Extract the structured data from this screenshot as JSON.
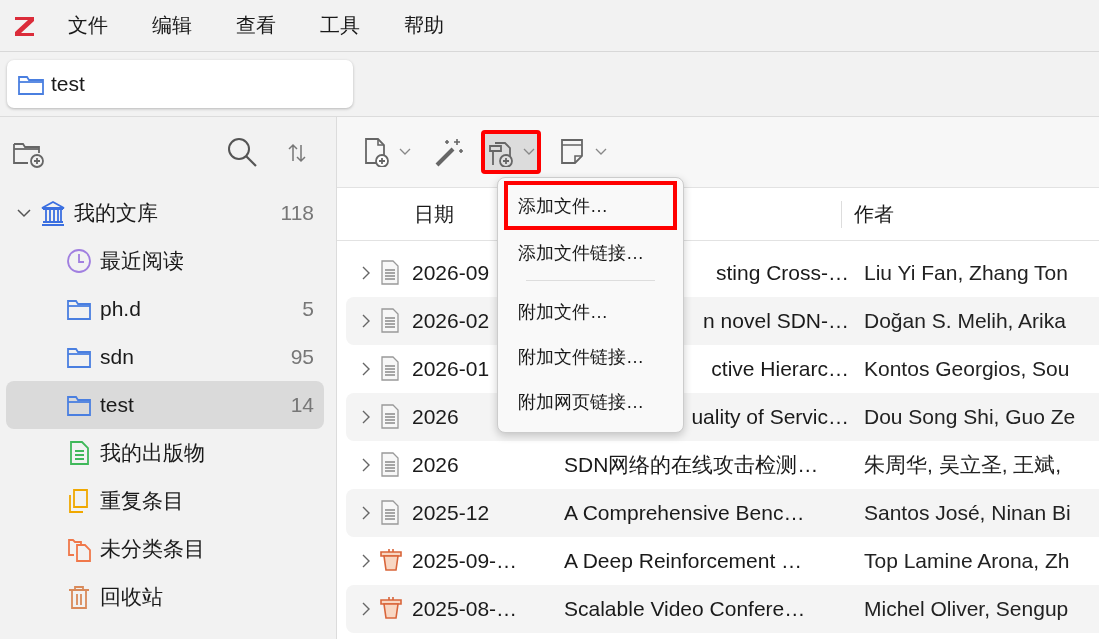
{
  "menu_bar": {
    "items": [
      "文件",
      "编辑",
      "查看",
      "工具",
      "帮助"
    ]
  },
  "tabs": [
    {
      "label": "test",
      "selected": true
    }
  ],
  "sidebar": {
    "items": [
      {
        "kind": "library",
        "label": "我的文库",
        "count": "118",
        "expanded": true,
        "selected": false,
        "children": [
          {
            "kind": "recent",
            "label": "最近阅读",
            "selected": false
          },
          {
            "kind": "folder",
            "label": "ph.d",
            "count": "5",
            "selected": false
          },
          {
            "kind": "folder",
            "label": "sdn",
            "count": "95",
            "selected": false
          },
          {
            "kind": "folder",
            "label": "test",
            "count": "14",
            "selected": true
          },
          {
            "kind": "publications",
            "label": "我的出版物",
            "selected": false
          },
          {
            "kind": "duplicates",
            "label": "重复条目",
            "selected": false
          },
          {
            "kind": "unfiled",
            "label": "未分类条目",
            "selected": false
          },
          {
            "kind": "trash",
            "label": "回收站",
            "selected": false
          }
        ]
      }
    ]
  },
  "toolbar": {
    "buttons": [
      {
        "kind": "new-item",
        "dropdown": true,
        "pressed": false,
        "highlighted": false
      },
      {
        "kind": "wand",
        "dropdown": false,
        "pressed": false,
        "highlighted": false
      },
      {
        "kind": "attach",
        "dropdown": true,
        "pressed": true,
        "highlighted": true
      },
      {
        "kind": "note",
        "dropdown": true,
        "pressed": false,
        "highlighted": false
      }
    ]
  },
  "table": {
    "columns": [
      "日期",
      "作者"
    ],
    "rows": [
      {
        "kind": "document",
        "date": "2026-09",
        "title": "sting Cross-…",
        "title_clipped": true,
        "author": "Liu Yi Fan, Zhang Ton"
      },
      {
        "kind": "document",
        "date": "2026-02",
        "title": "n novel SDN-…",
        "title_clipped": true,
        "author": "Doğan S. Melih, Arika"
      },
      {
        "kind": "document",
        "date": "2026-01",
        "title": "ctive Hierarc…",
        "title_clipped": true,
        "author": "Kontos Georgios, Sou"
      },
      {
        "kind": "document",
        "date": "2026",
        "title": "uality of Servic…",
        "title_clipped": true,
        "author": "Dou Song Shi, Guo Ze"
      },
      {
        "kind": "document",
        "date": "2026",
        "title": "SDN网络的在线攻击检测…",
        "title_clipped": false,
        "author": "朱周华, 吴立圣, 王斌,"
      },
      {
        "kind": "document",
        "date": "2025-12",
        "title": "A Comprehensive Benc…",
        "title_clipped": false,
        "author": "Santos José, Ninan Bi"
      },
      {
        "kind": "presentation",
        "date": "2025-09-…",
        "title": "A Deep Reinforcement …",
        "title_clipped": false,
        "author": "Top Lamine Arona, Zh"
      },
      {
        "kind": "presentation",
        "date": "2025-08-…",
        "title": "Scalable Video Confere…",
        "title_clipped": false,
        "author": "Michel Oliver, Sengup"
      }
    ]
  },
  "dropdown_menu": {
    "items": [
      {
        "kind": "item",
        "label": "添加文件…",
        "highlighted": true
      },
      {
        "kind": "item",
        "label": "添加文件链接…",
        "highlighted": false
      },
      {
        "kind": "separator"
      },
      {
        "kind": "item",
        "label": "附加文件…",
        "highlighted": false
      },
      {
        "kind": "item",
        "label": "附加文件链接…",
        "highlighted": false
      },
      {
        "kind": "item",
        "label": "附加网页链接…",
        "highlighted": false
      }
    ]
  }
}
